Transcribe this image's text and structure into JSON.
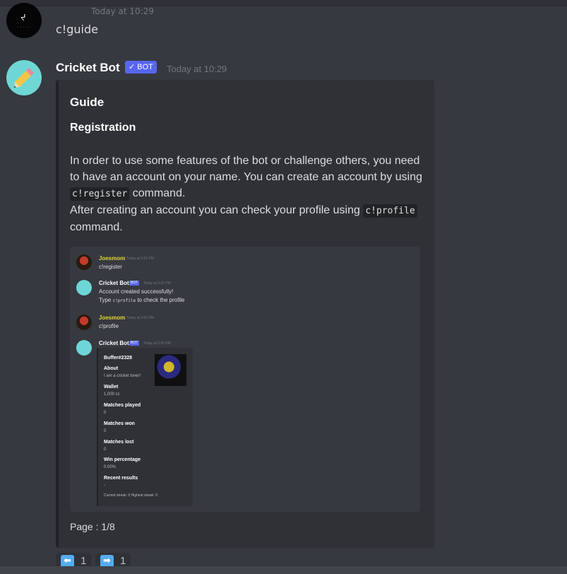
{
  "previous_message": {
    "timestamp": "Today at 10:29",
    "text": "c!guide"
  },
  "bot_message": {
    "author": "Cricket Bot",
    "tag": "✓ BOT",
    "timestamp": "Today at 10:29",
    "embed": {
      "title": "Guide",
      "field_name": "Registration",
      "desc_part1": "In order to use some features of the bot or challenge others, you need to have an account on your name. You can create an account by using ",
      "code_register": "c!register",
      "desc_part2": " command.",
      "desc_part3": "After creating an account you can check your profile using ",
      "code_profile": "c!profile",
      "desc_part4": " command.",
      "footer": "Page : 1/8"
    }
  },
  "inner_screenshot": {
    "msg1": {
      "author": "Joesmom",
      "time": "Today at 3:01 PM",
      "text": "c!register"
    },
    "msg2": {
      "author": "Cricket Bot",
      "tag": "BOT",
      "time": "Today at 3:01 PM",
      "line1": "Account created successfully!",
      "line2_a": "Type ",
      "line2_code": "c!profile",
      "line2_b": " to check the profile"
    },
    "msg3": {
      "author": "Joesmom",
      "time": "Today at 3:02 PM",
      "text": "c!profile"
    },
    "msg4": {
      "author": "Cricket Bot",
      "tag": "BOT",
      "time": "Today at 3:02 PM"
    },
    "profile": {
      "name": "Buffer#2328",
      "about_label": "About",
      "about_value": "I am a cricket lover!",
      "wallet_label": "Wallet",
      "wallet_value": "1,000 cc",
      "played_label": "Matches played",
      "played_value": "0",
      "won_label": "Matches won",
      "won_value": "0",
      "lost_label": "Matches lost",
      "lost_value": "0",
      "winpct_label": "Win percentage",
      "winpct_value": "0.00%",
      "recent_label": "Recent results",
      "recent_value": "-",
      "streak": "Current streak: 0  Highest streak: 0"
    }
  },
  "reactions": [
    {
      "icon": "left-arrow-icon",
      "symbol": "⬅",
      "count": "1",
      "color": "#55acee"
    },
    {
      "icon": "right-arrow-icon",
      "symbol": "➡",
      "count": "1",
      "color": "#55acee"
    }
  ]
}
